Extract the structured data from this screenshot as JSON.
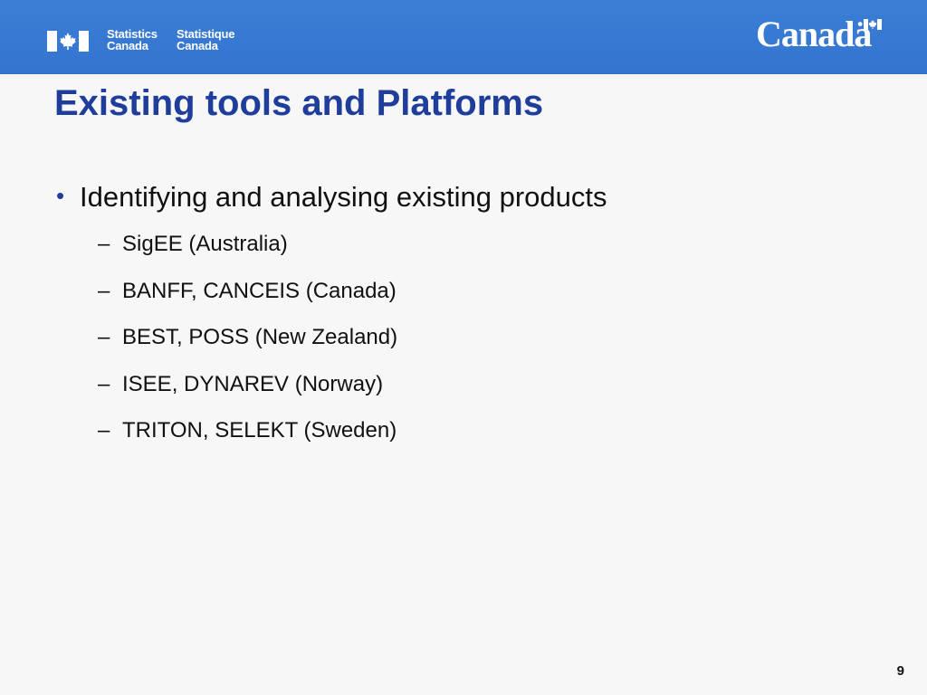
{
  "header": {
    "agency_en": [
      "Statistics",
      "Canada"
    ],
    "agency_fr": [
      "Statistique",
      "Canada"
    ],
    "wordmark": "Canadä"
  },
  "slide": {
    "title": "Existing tools and Platforms",
    "bullet": "Identifying and analysing existing products",
    "sub_items": [
      "SigEE (Australia)",
      "BANFF, CANCEIS (Canada)",
      "BEST, POSS (New Zealand)",
      "ISEE, DYNAREV (Norway)",
      "TRITON, SELEKT (Sweden)"
    ],
    "bullet_marker": "•",
    "sub_marker": "–",
    "page_number": "9"
  },
  "colors": {
    "header_band": "#3a7fd6",
    "title": "#1f3d9a",
    "background": "#f7f7f7"
  },
  "icons": {
    "agency_flag": "canada-flag-icon",
    "wordmark_flag": "canada-flag-icon"
  }
}
